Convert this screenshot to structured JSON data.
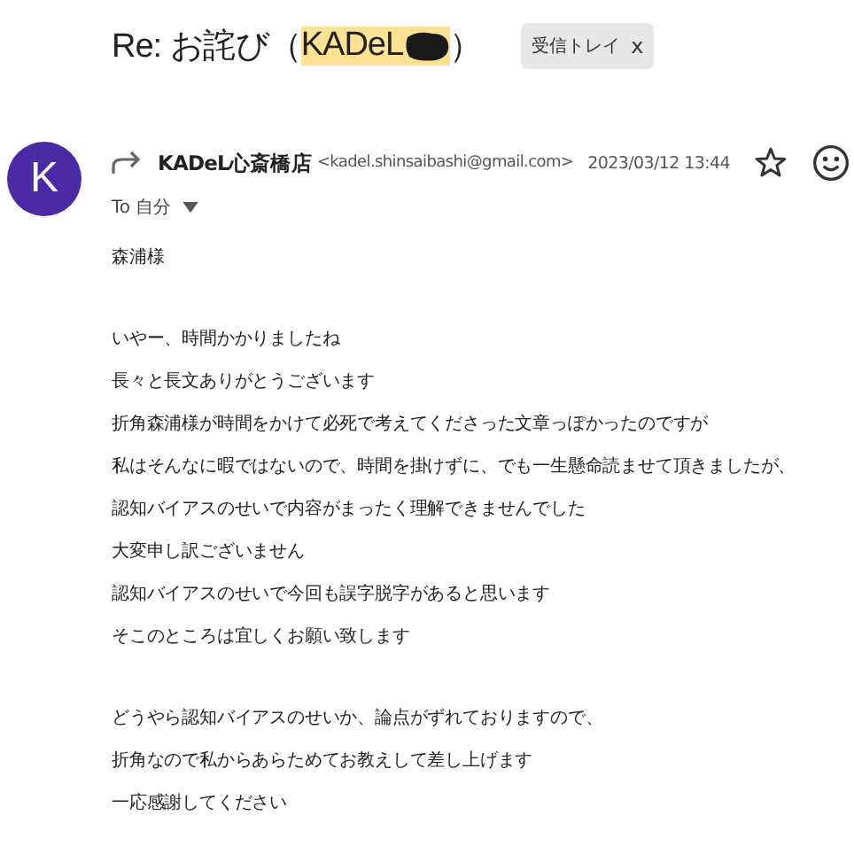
{
  "subject": {
    "prefix": "Re: お詫び（",
    "highlight": "KADeL",
    "redacted": true,
    "suffix": "）",
    "label_chip": {
      "label": "受信トレイ",
      "close": "x"
    }
  },
  "message": {
    "avatar_letter": "K",
    "sender_name": "KADeL心斎橋店",
    "sender_email": "<kadel.shinsaibashi@gmail.com>",
    "date": "2023/03/12 13:44",
    "starred": false,
    "recipient": "To 自分"
  },
  "body": [
    [
      "森浦様"
    ],
    [
      "いやー、時間かかりましたね",
      "長々と長文ありがとうございます",
      "折角森浦様が時間をかけて必死で考えてくださった文章っぽかったのですが",
      "私はそんなに暇ではないので、時間を掛けずに、でも一生懸命読ませて頂きましたが、",
      "認知バイアスのせいで内容がまったく理解できませんでした",
      "大変申し訳ございません",
      "認知バイアスのせいで今回も誤字脱字があると思います",
      "そこのところは宜しくお願い致します"
    ],
    [
      "どうやら認知バイアスのせいか、論点がずれておりますので、",
      "折角なので私からあらためてお教えして差し上げます",
      "一応感謝してください"
    ]
  ]
}
